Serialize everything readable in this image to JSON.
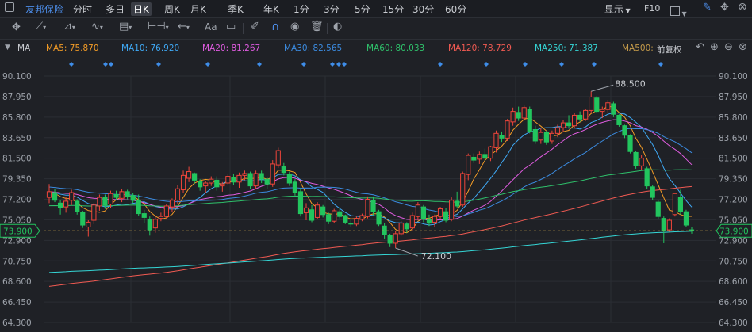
{
  "header": {
    "stock_name": "友邦保险",
    "timeframes": [
      {
        "label": "分时",
        "selected": false
      },
      {
        "label": "多日",
        "selected": false
      },
      {
        "label": "日K",
        "selected": true
      },
      {
        "label": "周K",
        "selected": false
      },
      {
        "label": "月K",
        "selected": false
      },
      {
        "label": "季K",
        "selected": false
      },
      {
        "label": "年K",
        "selected": false
      },
      {
        "label": "1分",
        "selected": false
      },
      {
        "label": "3分",
        "selected": false
      },
      {
        "label": "5分",
        "selected": false
      },
      {
        "label": "15分",
        "selected": false
      },
      {
        "label": "30分",
        "selected": false
      },
      {
        "label": "60分",
        "selected": false
      }
    ],
    "display_label": "显示",
    "f10_label": "F10"
  },
  "toolbar": {
    "tools": [
      "crosshair-icon",
      "line-tool-icon",
      "channel-tool-icon",
      "wave-tool-icon",
      "fib-tool-icon",
      "range-tool-icon",
      "arrow-tool-icon",
      "text-tool-icon",
      "note-tool-icon",
      "eraser-icon",
      "magnet-icon",
      "eye-icon",
      "trash-icon",
      "toggle-icon"
    ],
    "text_tool_label": "Aa"
  },
  "indicators": {
    "label": "MA",
    "items": [
      {
        "label": "MA5: 75.870",
        "color": "#f39c26"
      },
      {
        "label": "MA10: 76.920",
        "color": "#3fa9f5"
      },
      {
        "label": "MA20: 81.267",
        "color": "#e05ce0"
      },
      {
        "label": "MA30: 82.565",
        "color": "#3b8be0"
      },
      {
        "label": "MA60: 80.033",
        "color": "#2fc16b"
      },
      {
        "label": "MA120: 78.729",
        "color": "#f05a52"
      },
      {
        "label": "MA250: 71.387",
        "color": "#35d6d6"
      },
      {
        "label": "MA500:",
        "color": "#c49a4a"
      }
    ],
    "adjust_label": "前复权"
  },
  "chart_data": {
    "type": "candlestick",
    "y_ticks": [
      "90.100",
      "87.950",
      "85.800",
      "83.650",
      "81.500",
      "79.350",
      "77.200",
      "75.050",
      "72.900",
      "70.750",
      "68.600",
      "66.450",
      "64.300"
    ],
    "ylim": [
      64.3,
      90.1
    ],
    "current_price": "73.900",
    "annotations": [
      {
        "label": "88.500",
        "type": "high"
      },
      {
        "label": "72.100",
        "type": "low"
      }
    ],
    "candles": [
      [
        77.4,
        78.8,
        76.8,
        78.0
      ],
      [
        77.9,
        78.3,
        76.9,
        77.1
      ],
      [
        76.8,
        77.1,
        75.6,
        76.3
      ],
      [
        76.4,
        77.4,
        75.8,
        77.0
      ],
      [
        77.1,
        78.2,
        76.6,
        77.9
      ],
      [
        77.0,
        77.2,
        75.6,
        75.9
      ],
      [
        75.8,
        76.0,
        74.2,
        74.5
      ],
      [
        74.3,
        75.0,
        73.3,
        74.8
      ],
      [
        75.0,
        76.8,
        74.6,
        76.6
      ],
      [
        76.5,
        77.7,
        76.0,
        77.4
      ],
      [
        77.4,
        77.7,
        76.2,
        76.6
      ],
      [
        76.7,
        78.1,
        76.3,
        77.8
      ],
      [
        77.7,
        78.1,
        77.1,
        77.4
      ],
      [
        77.3,
        78.3,
        76.9,
        78.0
      ],
      [
        78.0,
        78.2,
        77.2,
        77.5
      ],
      [
        77.6,
        77.9,
        76.8,
        77.1
      ],
      [
        77.1,
        77.7,
        75.5,
        75.7
      ],
      [
        75.7,
        76.1,
        74.7,
        75.3
      ],
      [
        75.1,
        75.4,
        73.4,
        74.0
      ],
      [
        74.2,
        75.5,
        73.7,
        75.1
      ],
      [
        75.2,
        75.8,
        74.9,
        75.4
      ],
      [
        75.4,
        76.7,
        75.1,
        76.5
      ],
      [
        76.4,
        77.3,
        75.9,
        77.1
      ],
      [
        77.1,
        78.7,
        76.7,
        78.3
      ],
      [
        78.2,
        80.2,
        77.9,
        79.7
      ],
      [
        79.4,
        80.6,
        79.0,
        80.1
      ],
      [
        79.9,
        80.0,
        78.8,
        79.2
      ],
      [
        79.1,
        79.3,
        78.1,
        78.5
      ],
      [
        78.6,
        79.1,
        77.9,
        78.9
      ],
      [
        78.9,
        79.6,
        78.6,
        79.3
      ],
      [
        79.2,
        79.6,
        78.1,
        78.5
      ],
      [
        78.6,
        79.0,
        78.0,
        78.8
      ],
      [
        78.9,
        79.9,
        78.7,
        79.6
      ],
      [
        79.5,
        79.9,
        78.7,
        79.0
      ],
      [
        79.0,
        80.0,
        78.4,
        79.7
      ],
      [
        79.7,
        80.2,
        79.2,
        79.9
      ],
      [
        79.9,
        80.1,
        78.3,
        78.6
      ],
      [
        78.6,
        80.2,
        78.3,
        79.9
      ],
      [
        79.9,
        80.2,
        78.9,
        79.3
      ],
      [
        79.3,
        79.5,
        78.3,
        78.8
      ],
      [
        78.8,
        81.3,
        78.5,
        80.9
      ],
      [
        80.8,
        82.6,
        80.5,
        82.3
      ],
      [
        80.6,
        81.0,
        79.7,
        80.0
      ],
      [
        79.8,
        80.1,
        78.6,
        78.9
      ],
      [
        79.0,
        79.3,
        77.6,
        77.9
      ],
      [
        78.0,
        78.4,
        75.4,
        75.7
      ],
      [
        75.8,
        76.8,
        75.0,
        76.3
      ],
      [
        76.1,
        76.6,
        74.8,
        75.0
      ],
      [
        75.3,
        76.9,
        75.1,
        76.6
      ],
      [
        76.4,
        76.6,
        75.3,
        75.6
      ],
      [
        75.6,
        75.8,
        74.6,
        74.9
      ],
      [
        74.9,
        76.2,
        74.7,
        76.0
      ],
      [
        75.9,
        76.3,
        75.2,
        75.4
      ],
      [
        75.5,
        75.6,
        74.6,
        74.8
      ],
      [
        74.7,
        75.0,
        74.3,
        74.6
      ],
      [
        74.6,
        75.4,
        74.4,
        75.2
      ],
      [
        75.1,
        75.7,
        74.9,
        75.5
      ],
      [
        75.4,
        77.5,
        75.2,
        77.2
      ],
      [
        77.1,
        77.5,
        75.5,
        75.9
      ],
      [
        75.9,
        76.1,
        74.4,
        74.6
      ],
      [
        74.4,
        74.7,
        73.1,
        73.5
      ],
      [
        73.4,
        73.6,
        72.2,
        72.6
      ],
      [
        72.6,
        73.9,
        72.1,
        73.6
      ],
      [
        73.6,
        74.9,
        73.4,
        74.7
      ],
      [
        74.6,
        74.8,
        73.7,
        74.1
      ],
      [
        74.2,
        75.8,
        73.9,
        75.5
      ],
      [
        75.4,
        76.9,
        75.0,
        76.6
      ],
      [
        76.4,
        76.6,
        74.8,
        75.1
      ],
      [
        75.1,
        75.6,
        74.4,
        74.7
      ],
      [
        74.8,
        75.6,
        74.3,
        75.4
      ],
      [
        75.4,
        76.4,
        75.1,
        76.2
      ],
      [
        75.9,
        76.3,
        74.8,
        75.0
      ],
      [
        75.1,
        77.4,
        74.9,
        77.1
      ],
      [
        77.0,
        78.0,
        76.3,
        76.5
      ],
      [
        76.6,
        80.1,
        76.4,
        79.9
      ],
      [
        79.8,
        82.0,
        79.2,
        81.8
      ],
      [
        81.6,
        82.0,
        81.0,
        81.3
      ],
      [
        81.4,
        82.2,
        80.9,
        81.9
      ],
      [
        81.9,
        82.5,
        81.2,
        81.5
      ],
      [
        81.5,
        82.8,
        81.2,
        82.7
      ],
      [
        82.6,
        84.4,
        82.1,
        84.1
      ],
      [
        83.9,
        84.3,
        83.2,
        83.6
      ],
      [
        83.6,
        85.6,
        83.3,
        85.4
      ],
      [
        85.3,
        86.8,
        84.9,
        86.4
      ],
      [
        86.3,
        86.9,
        85.4,
        85.7
      ],
      [
        85.7,
        87.0,
        85.5,
        86.8
      ],
      [
        86.6,
        86.9,
        84.1,
        84.3
      ],
      [
        84.5,
        84.9,
        83.0,
        83.3
      ],
      [
        83.4,
        84.6,
        83.0,
        84.2
      ],
      [
        84.2,
        84.4,
        82.9,
        83.2
      ],
      [
        83.3,
        84.4,
        83.0,
        84.1
      ],
      [
        84.1,
        85.0,
        83.7,
        84.7
      ],
      [
        84.7,
        85.5,
        84.3,
        85.2
      ],
      [
        85.2,
        86.0,
        84.7,
        84.9
      ],
      [
        84.9,
        86.2,
        84.6,
        86.0
      ],
      [
        86.0,
        86.4,
        85.3,
        85.6
      ],
      [
        85.6,
        86.7,
        85.4,
        86.5
      ],
      [
        86.5,
        88.5,
        86.2,
        87.9
      ],
      [
        87.8,
        88.0,
        86.2,
        86.4
      ],
      [
        86.4,
        86.9,
        85.7,
        86.6
      ],
      [
        86.6,
        87.6,
        86.2,
        87.3
      ],
      [
        87.2,
        87.4,
        85.8,
        86.1
      ],
      [
        86.0,
        86.1,
        84.8,
        85.0
      ],
      [
        84.9,
        85.0,
        83.6,
        83.9
      ],
      [
        83.9,
        84.0,
        82.0,
        82.2
      ],
      [
        82.1,
        82.3,
        80.4,
        80.7
      ],
      [
        80.7,
        81.8,
        80.3,
        81.5
      ],
      [
        80.4,
        80.6,
        78.3,
        78.6
      ],
      [
        78.5,
        78.7,
        77.1,
        77.4
      ],
      [
        76.9,
        77.1,
        75.1,
        75.4
      ],
      [
        75.2,
        75.4,
        72.6,
        73.9
      ],
      [
        74.0,
        75.2,
        73.8,
        75.0
      ],
      [
        75.6,
        77.9,
        75.4,
        77.8
      ],
      [
        77.4,
        78.2,
        75.6,
        75.9
      ],
      [
        75.9,
        76.1,
        74.3,
        74.5
      ],
      [
        74.0,
        74.3,
        73.6,
        73.9
      ]
    ]
  }
}
